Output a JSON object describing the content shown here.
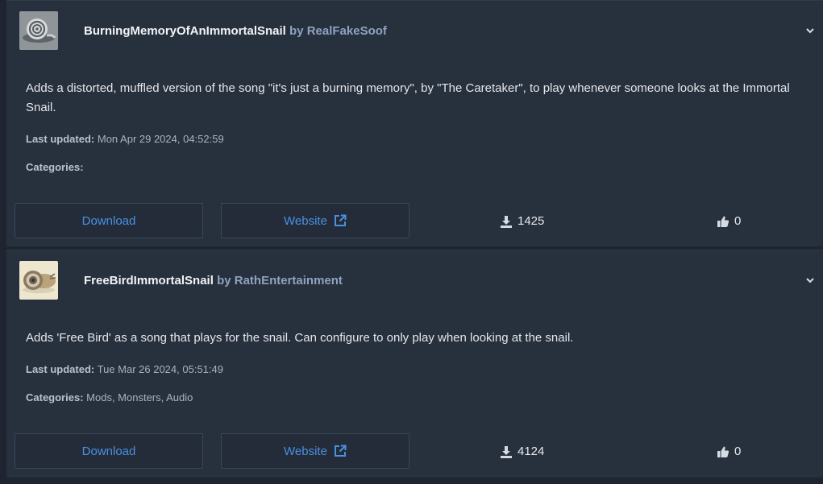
{
  "mods": [
    {
      "name": "BurningMemoryOfAnImmortalSnail",
      "by_text": "by RealFakeSoof",
      "description": "Adds a distorted, muffled version of the song \"it's just a burning memory\", by \"The Caretaker\", to play whenever someone looks at the Immortal Snail.",
      "last_updated_label": "Last updated:",
      "last_updated_value": "Mon Apr 29 2024, 04:52:59",
      "categories_label": "Categories:",
      "categories_value": "",
      "download_label": "Download",
      "website_label": "Website",
      "downloads": "1425",
      "likes": "0",
      "thumbnail_icon": "snail-shell-icon"
    },
    {
      "name": "FreeBirdImmortalSnail",
      "by_text": "by RathEntertainment",
      "description": "Adds 'Free Bird' as a song that plays for the snail. Can configure to only play when looking at the snail.",
      "last_updated_label": "Last updated:",
      "last_updated_value": "Tue Mar 26 2024, 05:51:49",
      "categories_label": "Categories:",
      "categories_value": "Mods, Monsters, Audio",
      "download_label": "Download",
      "website_label": "Website",
      "downloads": "4124",
      "likes": "0",
      "thumbnail_icon": "snail-figure-icon"
    }
  ],
  "colors": {
    "page_bg": "#1e2530",
    "card_bg": "#27303d",
    "link_blue": "#4a90e2",
    "author_color": "#8fa3c0"
  }
}
